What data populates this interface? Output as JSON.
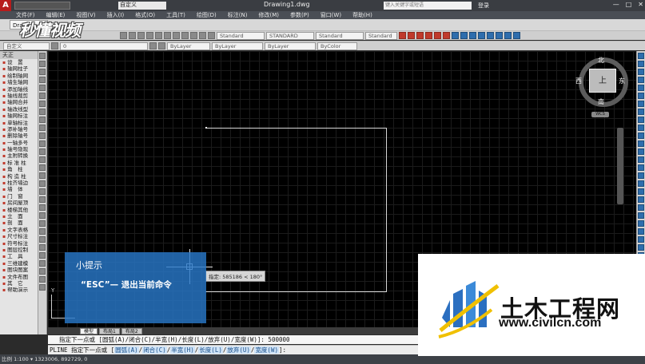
{
  "title_bar": {
    "app_letter": "A",
    "workspace": "自定义",
    "doc_title": "Drawing1.dwg",
    "search_placeholder": "键入关键字或短语",
    "login": "登录",
    "min": "—",
    "max": "□",
    "close": "✕"
  },
  "menu": [
    "文件(F)",
    "编辑(E)",
    "视图(V)",
    "插入(I)",
    "格式(O)",
    "工具(T)",
    "绘图(D)",
    "标注(N)",
    "修改(M)",
    "参数(P)",
    "窗口(W)",
    "帮助(H)"
  ],
  "doc_tab": "Drawi",
  "logo_text": "秒懂视频",
  "toolbar": {
    "styles": [
      "Standard",
      "STANDARD",
      "Standard",
      "Standard"
    ],
    "workspace2": "自定义",
    "layer": "0",
    "linetype": "ByLayer",
    "lineweight": "ByLayer",
    "color": "ByColor",
    "layer2": "ByLayer"
  },
  "left_palette": {
    "header": "天正",
    "items": [
      "设　置",
      "轴网柱子",
      "绘制轴网",
      "墙生轴网",
      "添加轴线",
      "轴线裁剪",
      "轴网合并",
      "轴改线型",
      "轴网标注",
      "单轴标注",
      "添补轴号",
      "删除轴号",
      "一轴多号",
      "轴号隐现",
      "主附转换",
      "标 准 柱",
      "角　柱",
      "构 造 柱",
      "柱齐墙边",
      "墙　体",
      "门　窗",
      "房间屋顶",
      "楼梯其他",
      "立　面",
      "剖　面",
      "文字表格",
      "尺寸标注",
      "符号标注",
      "图层控制",
      "工　具",
      "三维建模",
      "图块图案",
      "文件布图",
      "其　它",
      "帮助演示"
    ]
  },
  "view_cube": {
    "north": "北",
    "south": "南",
    "west": "西",
    "east": "东",
    "face": "上",
    "wcs": "WCS"
  },
  "canvas": {
    "dyn_tip": "指定: 585186 < 180°",
    "ucs_y": "Y"
  },
  "layout_tabs": [
    "模型",
    "布局1",
    "布局2"
  ],
  "command": {
    "line1": "指定下一点或 [圆弧(A)/闭合(C)/半宽(H)/长度(L)/放弃(U)/宽度(W)]: 500000",
    "prefix": "PLINE 指定下一点或 [",
    "opts": [
      "圆弧(A)",
      "闭合(C)",
      "半宽(H)",
      "长度(L)",
      "放弃(U)",
      "宽度(W)"
    ],
    "suffix": "]:"
  },
  "status": "比例 1:100 ▾ 1323006, 892729, 0",
  "tip_card": {
    "title": "小提示",
    "body": "“ESC”— 退出当前命令"
  },
  "watermark": {
    "title": "土木工程网",
    "url": "www.civilcn.com"
  },
  "colors": {
    "canvas": "#000000",
    "tip_card": "#2878c8",
    "accent_red": "#c0392b"
  }
}
